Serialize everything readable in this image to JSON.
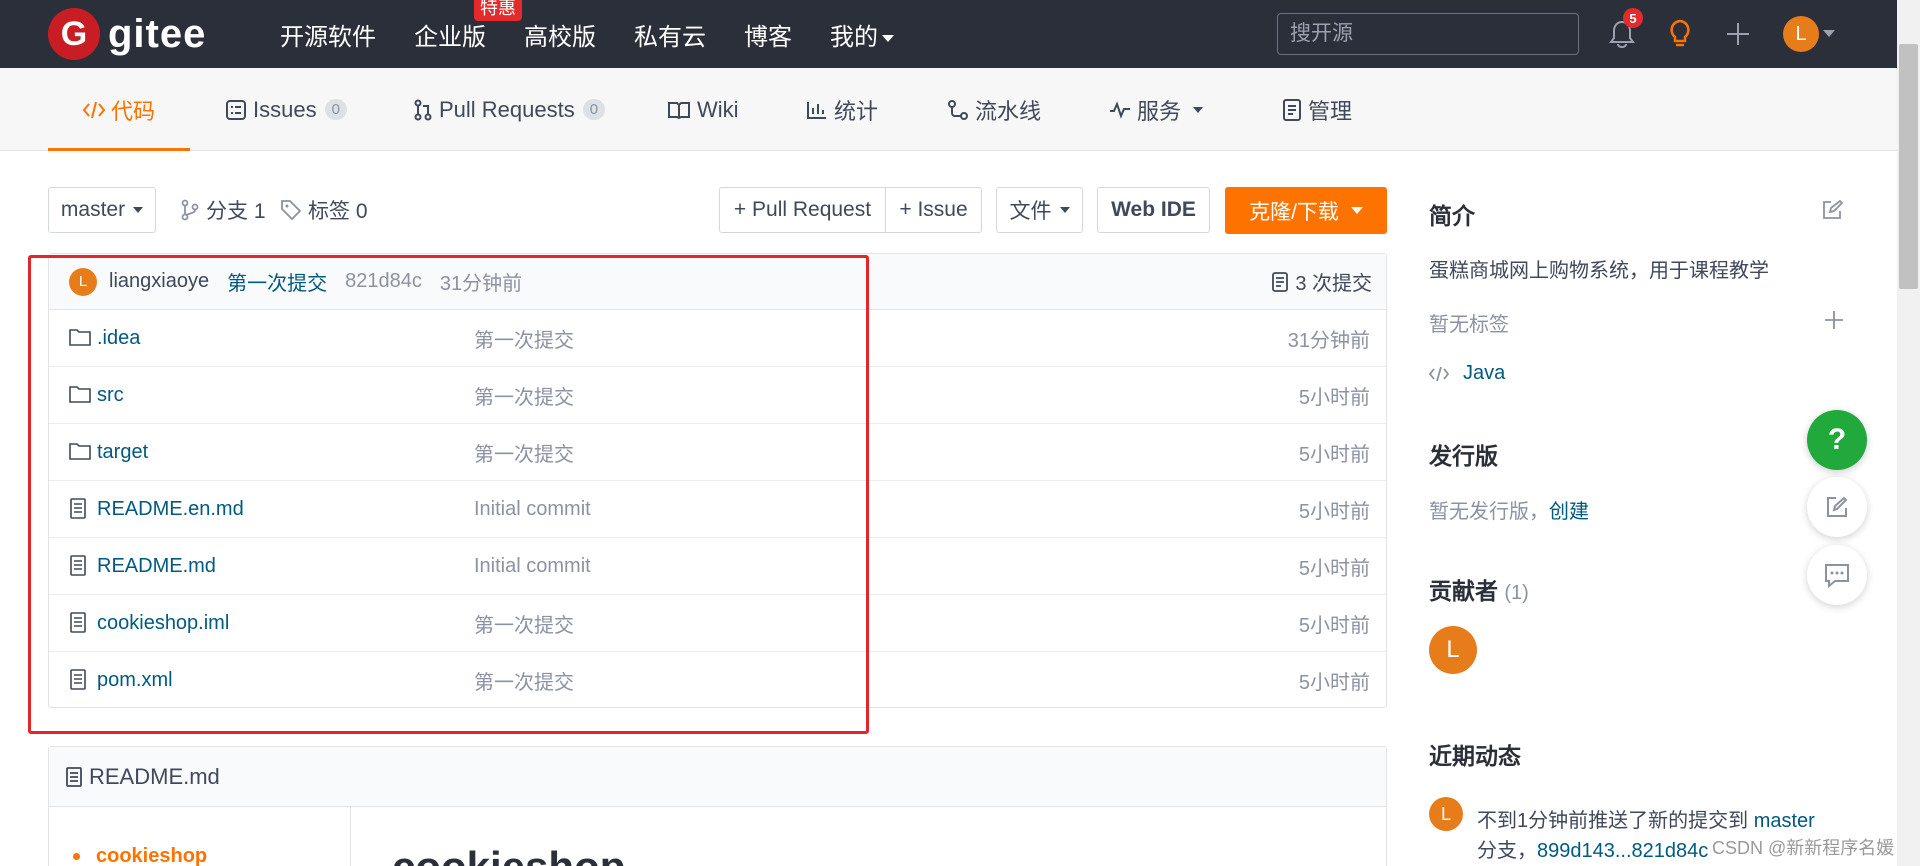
{
  "topnav": {
    "logo_letter": "G",
    "logo_text": "gitee",
    "links": [
      "开源软件",
      "企业版",
      "高校版",
      "私有云",
      "博客",
      "我的"
    ],
    "enterprise_badge": "特惠",
    "search_placeholder": "搜开源",
    "notification_count": "5",
    "avatar_letter": "L",
    "icons": [
      "bell-icon",
      "lightbulb-icon",
      "plus-icon",
      "avatar",
      "chevron-down-icon"
    ]
  },
  "tabs": {
    "code": "代码",
    "issues": "Issues",
    "issues_count": "0",
    "pulls": "Pull Requests",
    "pulls_count": "0",
    "wiki": "Wiki",
    "stats": "统计",
    "pipeline": "流水线",
    "services": "服务",
    "manage": "管理"
  },
  "toolbar": {
    "branch": "master",
    "branches": "分支 1",
    "tags": "标签 0",
    "pull_request": "+ Pull Request",
    "issue": "+ Issue",
    "file": "文件",
    "web_ide": "Web IDE",
    "clone": "克隆/下载"
  },
  "commit": {
    "avatar_letter": "L",
    "author": "liangxiaoye",
    "message": "第一次提交",
    "hash": "821d84c",
    "time": "31分钟前",
    "total": "3 次提交"
  },
  "files": [
    {
      "type": "folder",
      "name": ".idea",
      "message": "第一次提交",
      "time": "31分钟前"
    },
    {
      "type": "folder",
      "name": "src",
      "message": "第一次提交",
      "time": "5小时前"
    },
    {
      "type": "folder",
      "name": "target",
      "message": "第一次提交",
      "time": "5小时前"
    },
    {
      "type": "file",
      "name": "README.en.md",
      "message": "Initial commit",
      "time": "5小时前"
    },
    {
      "type": "file",
      "name": "README.md",
      "message": "Initial commit",
      "time": "5小时前"
    },
    {
      "type": "file",
      "name": "cookieshop.iml",
      "message": "第一次提交",
      "time": "5小时前"
    },
    {
      "type": "file",
      "name": "pom.xml",
      "message": "第一次提交",
      "time": "5小时前"
    }
  ],
  "readme": {
    "filename": "README.md",
    "toc_item": "cookieshop",
    "title": "cookieshop"
  },
  "sidebar": {
    "intro_heading": "简介",
    "description": "蛋糕商城网上购物系统，用于课程教学",
    "no_tags": "暂无标签",
    "language": "Java",
    "releases_heading": "发行版",
    "no_releases": "暂无发行版，",
    "create": "创建",
    "contributors_heading": "贡献者",
    "contributors_count": "(1)",
    "contributor_letter": "L",
    "activity_heading": "近期动态",
    "activity_avatar": "L",
    "activity_line1": "不到1分钟前推送了新的提交到",
    "activity_branch": "master",
    "activity_line2": "分支，",
    "activity_range": "899d143...821d84c"
  },
  "floating": {
    "help": "?"
  },
  "watermark": "CSDN @新新程序名媛",
  "colors": {
    "accent": "#fe7300",
    "nav_bg": "#2b2f3a",
    "link": "#005980",
    "highlight_box": "#e3262a",
    "help_green": "#21a93b"
  }
}
